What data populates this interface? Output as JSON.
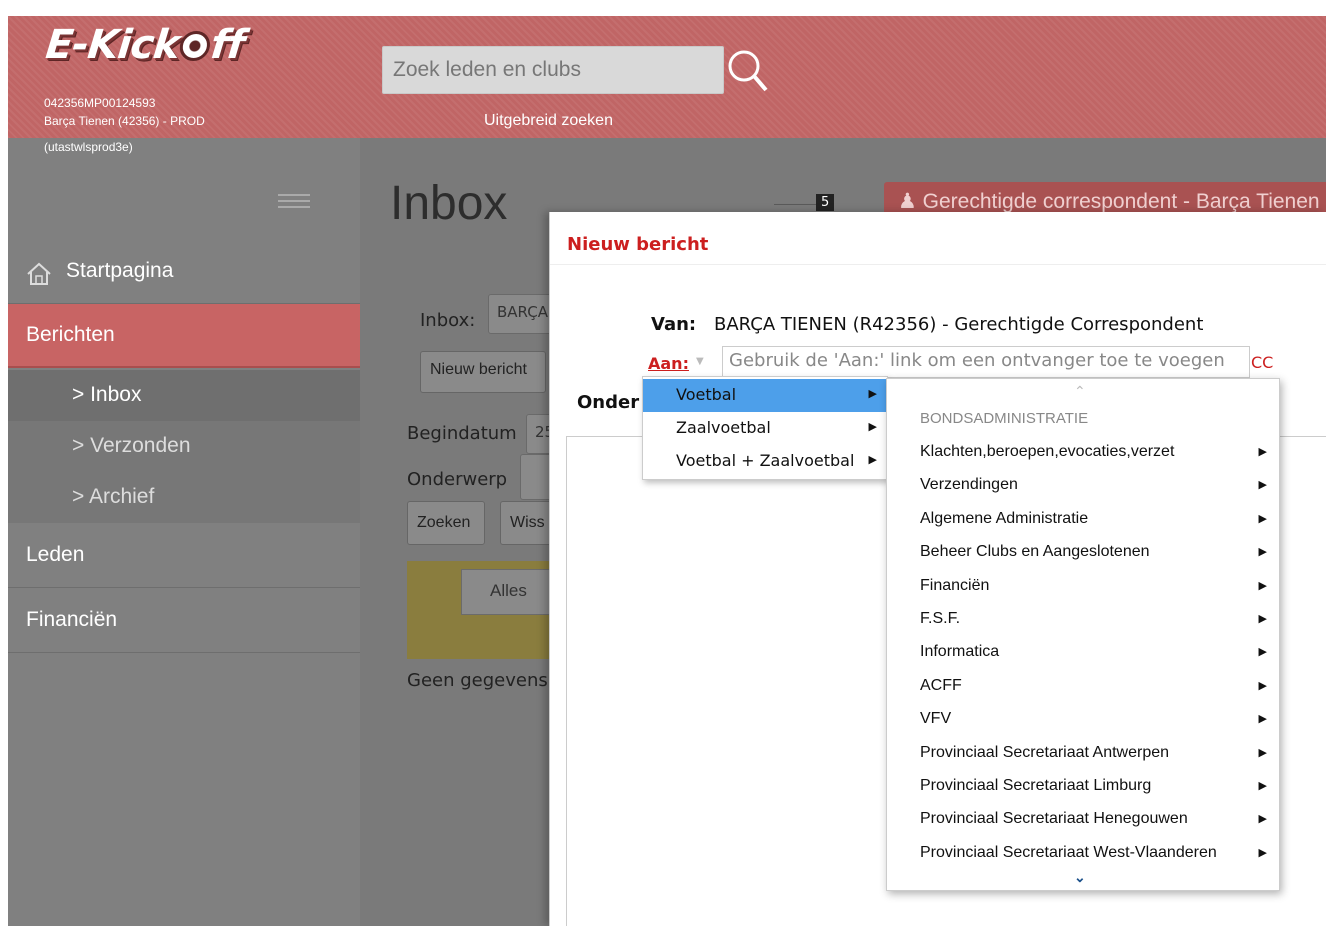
{
  "header": {
    "logo_text_1": "E-Kick",
    "logo_text_2": "ff",
    "session_id": "042356MP00124593",
    "club_line": "Barça Tienen (42356) - PROD",
    "server_line": "(utastwlsprod3e)",
    "search_placeholder": "Zoek leden en clubs",
    "advanced_search": "Uitgebreid zoeken"
  },
  "sidebar": {
    "items": {
      "start": "Startpagina",
      "berichten": "Berichten",
      "inbox": ">  Inbox",
      "verzonden": ">  Verzonden",
      "archief": ">  Archief",
      "leden": "Leden",
      "financien": "Financiën"
    }
  },
  "main": {
    "title": "Inbox",
    "unread_count": "5",
    "correspondent_button": "Gerechtigde correspondent - Barça Tienen",
    "inbox_label": "Inbox:",
    "inbox_value": "BARÇA",
    "new_message_button": "Nieuw bericht",
    "begindatum_label": "Begindatum",
    "begindatum_value": "25",
    "onderwerp_label": "Onderwerp",
    "search_button": "Zoeken",
    "clear_button": "Wiss",
    "filter_all": "Alles",
    "empty_text": "Geen gegevens"
  },
  "modal": {
    "title": "Nieuw bericht",
    "from_label": "Van:",
    "from_value": "BARÇA TIENEN (R42356) - Gerechtigde Correspondent",
    "to_label": "Aan:",
    "to_placeholder": "Gebruik de 'Aan:' link om een ontvanger toe te voegen",
    "cc_label": "CC",
    "subject_label": "Onder"
  },
  "menu1": {
    "items": [
      "Voetbal",
      "Zaalvoetbal",
      "Voetbal + Zaalvoetbal"
    ]
  },
  "menu2": {
    "header": "BONDSADMINISTRATIE",
    "items": [
      "Klachten,beroepen,evocaties,verzet",
      "Verzendingen",
      "Algemene Administratie",
      "Beheer Clubs en Aangeslotenen",
      "Financiën",
      "F.S.F.",
      "Informatica",
      "ACFF",
      "VFV",
      "Provinciaal Secretariaat Antwerpen",
      "Provinciaal Secretariaat Limburg",
      "Provinciaal Secretariaat Henegouwen",
      "Provinciaal Secretariaat West-Vlaanderen"
    ]
  },
  "colors": {
    "header_bg": "#c06565",
    "sidebar_bg": "#808080",
    "active_nav": "#c86464",
    "accent_red": "#cc1f1f",
    "menu_highlight": "#4d9fea"
  }
}
